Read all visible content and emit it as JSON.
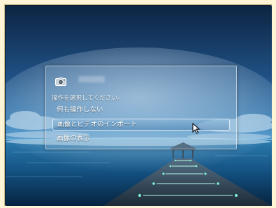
{
  "dialog": {
    "prompt": "操作を選択してください。",
    "options": [
      {
        "label": "何も操作しない"
      },
      {
        "label": "画像とビデオのインポート",
        "highlighted": true
      },
      {
        "label": "画像の表示"
      }
    ]
  },
  "icons": {
    "device": "camera-icon",
    "pointer": "mouse-pointer-icon"
  },
  "colors": {
    "outer_background": "#fff5d6",
    "sky": "#2f6fa6",
    "sea": "#1a5a86"
  }
}
